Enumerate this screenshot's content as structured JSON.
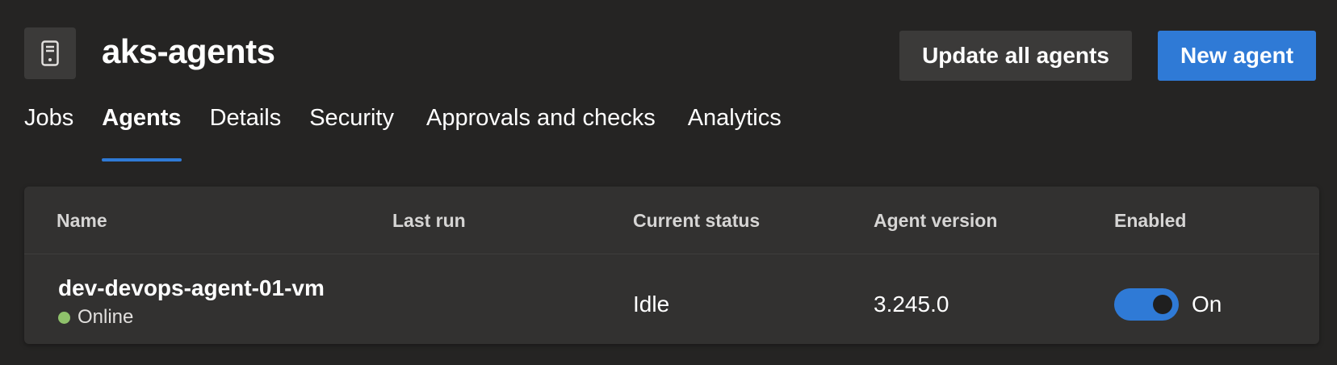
{
  "header": {
    "icon": "server-icon",
    "title": "aks-agents",
    "update_all_label": "Update all agents",
    "new_agent_label": "New agent"
  },
  "tabs": [
    {
      "label": "Jobs",
      "active": false
    },
    {
      "label": "Agents",
      "active": true
    },
    {
      "label": "Details",
      "active": false
    },
    {
      "label": "Security",
      "active": false
    },
    {
      "label": "Approvals and checks",
      "active": false
    },
    {
      "label": "Analytics",
      "active": false
    }
  ],
  "table": {
    "columns": [
      "Name",
      "Last run",
      "Current status",
      "Agent version",
      "Enabled"
    ],
    "rows": [
      {
        "name": "dev-devops-agent-01-vm",
        "state": "Online",
        "last_run": "",
        "current_status": "Idle",
        "agent_version": "3.245.0",
        "enabled": true,
        "enabled_label": "On"
      }
    ]
  },
  "colors": {
    "accent": "#2f7ad6",
    "background": "#252423",
    "card": "#323130",
    "online": "#8fc16b"
  }
}
